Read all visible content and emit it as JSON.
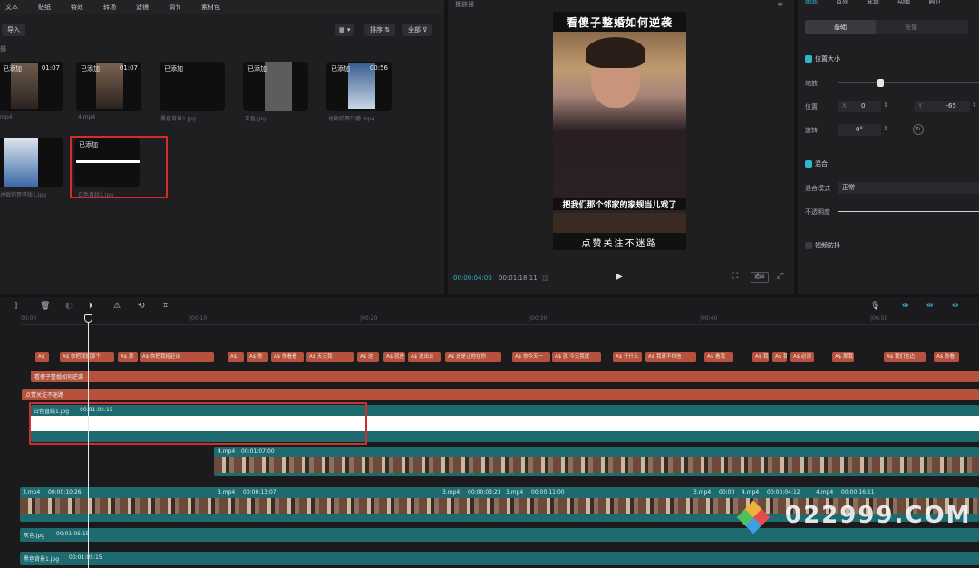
{
  "media": {
    "tabs": [
      "文本",
      "贴纸",
      "特效",
      "转场",
      "滤镜",
      "调节",
      "素材包"
    ],
    "import_label": "导入",
    "sort_label": "排序",
    "all_label": "全部",
    "items": [
      {
        "added": "已添加",
        "duration": "01:07",
        "filename": "mp4"
      },
      {
        "added": "已添加",
        "duration": "01:07",
        "filename": "4.mp4"
      },
      {
        "added": "已添加",
        "duration": "",
        "filename": "黑色背景1.jpg"
      },
      {
        "added": "已添加",
        "duration": "",
        "filename": "灰色.jpg"
      },
      {
        "added": "已添加",
        "duration": "00:56",
        "filename": "总裁帅哥口播.mp4"
      },
      {
        "added": "",
        "duration": "",
        "filename": "总裁帅哥竖版1.jpg"
      },
      {
        "added": "已添加",
        "duration": "",
        "filename": "白色直线1.jpg"
      }
    ]
  },
  "player": {
    "title": "播放器",
    "video_top_caption": "看傻子整婚如何逆袭",
    "video_sub_caption": "把我们那个邻家的家规当儿戏了",
    "video_bottom_caption": "点赞关注不迷路",
    "current_time": "00:00:04:00",
    "total_time": "00:01:18:11",
    "ratio_label": "适应"
  },
  "props": {
    "tabs": [
      "画面",
      "音频",
      "变速",
      "动画",
      "调节"
    ],
    "subtabs": [
      "基础",
      "抠像"
    ],
    "position_size_label": "位置大小",
    "scale_label": "缩放",
    "position_label": "位置",
    "x_label": "X",
    "x_value": "0",
    "y_label": "Y",
    "y_value": "-65",
    "rotate_label": "旋转",
    "rotate_value": "0°",
    "blend_label": "混合",
    "blend_mode_label": "混合模式",
    "blend_mode_value": "正常",
    "opacity_label": "不透明度",
    "stabilize_label": "视频防抖",
    "scale_level": 0.3
  },
  "timeline": {
    "ruler": [
      "00:00",
      "|00:10",
      "|00:20",
      "|00:30",
      "|00:40",
      "|00:50"
    ],
    "text_clips": [
      "A$",
      "A$ 你把我们那个",
      "A$ 那",
      "A$ 你把我给赶出",
      "A$",
      "A$ 你",
      "A$ 你看看",
      "A$ 天天我",
      "A$ 这",
      "A$ 就是",
      "A$ 说出去",
      "A$ 这是让他在你",
      "A$ 你今天一",
      "A$ 就 今天我就",
      "A$ 开什么",
      "A$ 我就不相信",
      "A$ 看我",
      "A$ 我",
      "A$ 我",
      "A$ 必须",
      "A$ 那我",
      "A$ 我们这边",
      "A$ 你看"
    ],
    "title_track_1": "看傻子整婚如何逆袭",
    "title_track_2": "点赞关注不迷路",
    "white_clip_name": "白色直线1.jpg",
    "white_clip_duration": "00:01:02:15",
    "video_4mp4_name": "4.mp4",
    "video_4mp4_duration": "00:01:07:00",
    "main_track_labels": [
      {
        "name": "3.mp4",
        "duration": "00:00:10:26"
      },
      {
        "name": "3.mp4",
        "duration": "00:00:13:07"
      },
      {
        "name": "3.mp4",
        "duration": "00:00:03:23"
      },
      {
        "name": "3.mp4",
        "duration": "00:00:11:00"
      },
      {
        "name": "3.mp4",
        "duration": "00:00"
      },
      {
        "name": "4.mp4",
        "duration": "00:00:04:12"
      },
      {
        "name": "4.mp4",
        "duration": "00:00:16:11"
      }
    ],
    "gray_clip_name": "灰色.jpg",
    "gray_clip_duration": "00:01:05:15",
    "black_clip_name": "黑色背景1.jpg",
    "black_clip_duration": "00:01:05:15"
  },
  "watermark": "022999.COM",
  "colors": {
    "accent": "#2fb6c9",
    "text_clip": "#b5513c",
    "video_track": "#1d6b6f",
    "highlight": "#d62b2b"
  }
}
